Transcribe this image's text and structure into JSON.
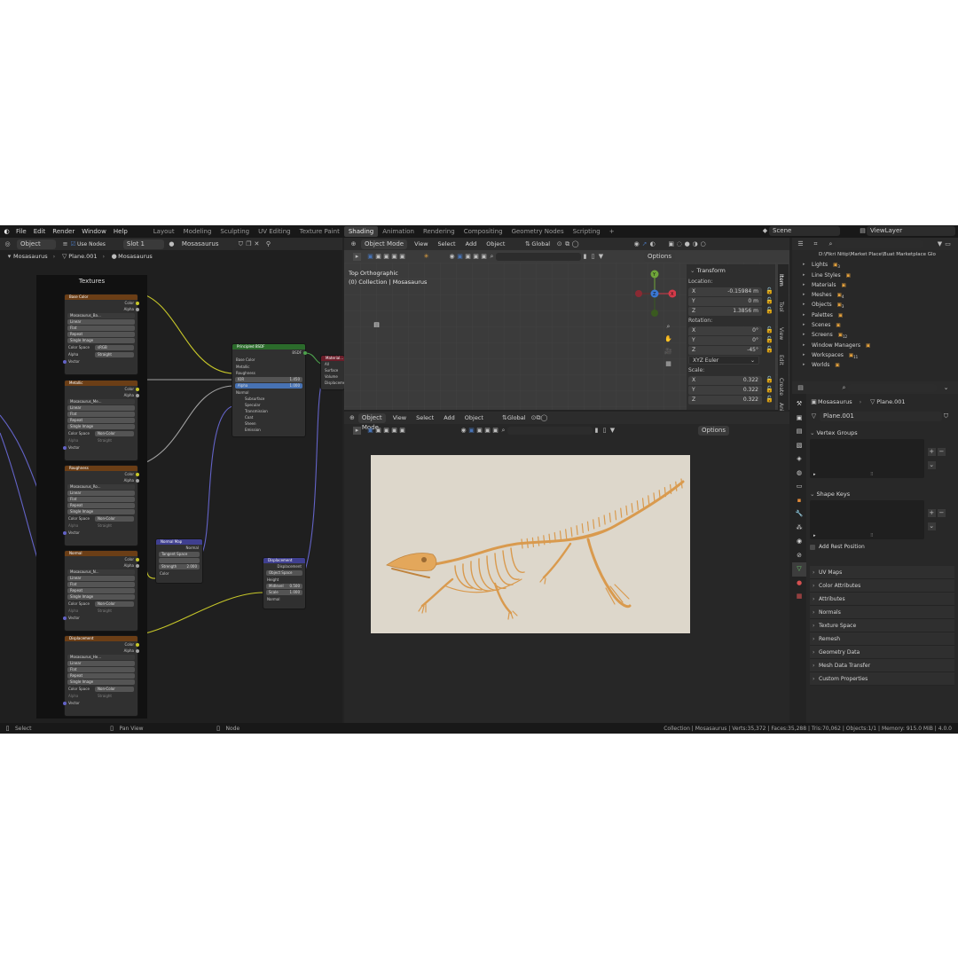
{
  "topbar": {
    "menus": [
      "File",
      "Edit",
      "Render",
      "Window",
      "Help"
    ],
    "workspaces": [
      "Layout",
      "Modeling",
      "Sculpting",
      "UV Editing",
      "Texture Paint",
      "Shading",
      "Animation",
      "Rendering",
      "Compositing",
      "Geometry Nodes",
      "Scripting"
    ],
    "active_workspace": "Shading",
    "add_tab": "+",
    "scene": "Scene",
    "view_layer": "ViewLayer"
  },
  "node_editor": {
    "object_type": "Object",
    "use_nodes": "Use Nodes",
    "slot": "Slot 1",
    "material": "Mosasaurus",
    "breadcrumb": [
      "Mosasaurus",
      "Plane.001",
      "Mosasaurus"
    ],
    "frame_label": "Textures",
    "texture_nodes": [
      {
        "title": "Base Color",
        "image": "Mosasaurus_Ba...",
        "interp": "Linear",
        "proj": "Flat",
        "ext": "Repeat",
        "source": "Single Image",
        "cs_label": "Color Space",
        "cs": "sRGB",
        "alpha_label": "Alpha",
        "alpha": "Straight"
      },
      {
        "title": "Metallic",
        "image": "Mosasaurus_Me...",
        "interp": "Linear",
        "proj": "Flat",
        "ext": "Repeat",
        "source": "Single Image",
        "cs_label": "Color Space",
        "cs": "Non-Color",
        "alpha_label": "Alpha",
        "alpha": "Straight"
      },
      {
        "title": "Roughness",
        "image": "Mosasaurus_Ro...",
        "interp": "Linear",
        "proj": "Flat",
        "ext": "Repeat",
        "source": "Single Image",
        "cs_label": "Color Space",
        "cs": "Non-Color",
        "alpha_label": "Alpha",
        "alpha": "Straight"
      },
      {
        "title": "Normal",
        "image": "Mosasaurus_N...",
        "interp": "Linear",
        "proj": "Flat",
        "ext": "Repeat",
        "source": "Single Image",
        "cs_label": "Color Space",
        "cs": "Non-Color",
        "alpha_label": "Alpha",
        "alpha": "Straight"
      },
      {
        "title": "Displacement",
        "image": "Mosasaurus_He...",
        "interp": "Linear",
        "proj": "Flat",
        "ext": "Repeat",
        "source": "Single Image",
        "cs_label": "Color Space",
        "cs": "Non-Color",
        "alpha_label": "Alpha",
        "alpha": "Straight"
      }
    ],
    "socket_color": "Color",
    "socket_alpha": "Alpha",
    "socket_vector": "Vector",
    "bsdf": {
      "title": "Principled BSDF",
      "out": "BSDF",
      "inputs": [
        "Base Color",
        "Metallic",
        "Roughness"
      ],
      "ior_label": "IOR",
      "ior": "1.450",
      "alpha_label": "Alpha",
      "alpha": "1.000",
      "normal": "Normal",
      "subs": [
        "Subsurface",
        "Specular",
        "Transmission",
        "Coat",
        "Sheen",
        "Emission"
      ]
    },
    "material_output": {
      "title": "Material...",
      "target": "All",
      "inputs": [
        "Surface",
        "Volume",
        "Displacement"
      ]
    },
    "normal_map": {
      "title": "Normal Map",
      "out": "Normal",
      "space": "Tangent Space",
      "strength_label": "Strength",
      "strength": "2.000",
      "color": "Color"
    },
    "displacement": {
      "title": "Displacement",
      "out": "Displacement",
      "space": "Object Space",
      "height": "Height",
      "mid_label": "Midlevel",
      "mid": "0.500",
      "scale_label": "Scale",
      "scale": "1.000",
      "normal": "Normal"
    }
  },
  "viewport_top": {
    "mode": "Object Mode",
    "menus": [
      "View",
      "Select",
      "Add",
      "Object"
    ],
    "orientation": "Global",
    "options": "Options",
    "view_name": "Top Orthographic",
    "collection": "(0) Collection | Mosasaurus",
    "transform": {
      "title": "Transform",
      "location_label": "Location:",
      "location": [
        {
          "axis": "X",
          "value": "-0.15984 m"
        },
        {
          "axis": "Y",
          "value": "0 m"
        },
        {
          "axis": "Z",
          "value": "1.3856 m"
        }
      ],
      "rotation_label": "Rotation:",
      "rotation": [
        {
          "axis": "X",
          "value": "0°"
        },
        {
          "axis": "Y",
          "value": "0°"
        },
        {
          "axis": "Z",
          "value": "-45°"
        }
      ],
      "rotation_mode": "XYZ Euler",
      "scale_label": "Scale:",
      "scale": [
        {
          "axis": "X",
          "value": "0.322"
        },
        {
          "axis": "Y",
          "value": "0.322"
        },
        {
          "axis": "Z",
          "value": "0.322"
        }
      ]
    },
    "side_tabs": [
      "Item",
      "Tool",
      "View",
      "Edit",
      "Create",
      "Animation"
    ]
  },
  "viewport_bottom": {
    "mode": "Object Mode",
    "menus": [
      "View",
      "Select",
      "Add",
      "Object"
    ],
    "orientation": "Global",
    "options": "Options"
  },
  "outliner": {
    "path": "D:\\Fikri Nitip\\Market Place\\Buat Marketplace Glo",
    "items": [
      {
        "label": "Lights",
        "count": "3"
      },
      {
        "label": "Line Styles",
        "count": ""
      },
      {
        "label": "Materials",
        "count": ""
      },
      {
        "label": "Meshes",
        "count": "4"
      },
      {
        "label": "Objects",
        "count": "3"
      },
      {
        "label": "Palettes",
        "count": ""
      },
      {
        "label": "Scenes",
        "count": ""
      },
      {
        "label": "Screens",
        "count": "12"
      },
      {
        "label": "Window Managers",
        "count": ""
      },
      {
        "label": "Workspaces",
        "count": "11"
      },
      {
        "label": "Worlds",
        "count": ""
      }
    ]
  },
  "properties": {
    "object": "Mosasaurus",
    "mesh": "Plane.001",
    "mesh_field": "Plane.001",
    "vertex_groups": "Vertex Groups",
    "shape_keys": "Shape Keys",
    "add_rest": "Add Rest Position",
    "panels": [
      "UV Maps",
      "Color Attributes",
      "Attributes",
      "Normals",
      "Texture Space",
      "Remesh",
      "Geometry Data",
      "Mesh Data Transfer",
      "Custom Properties"
    ]
  },
  "statusbar": {
    "select": "Select",
    "pan": "Pan View",
    "node": "Node",
    "stats": "Collection | Mosasaurus | Verts:35,372 | Faces:35,288 | Tris:70,062 | Objects:1/1 | Memory: 915.0 MiB | 4.0.0"
  },
  "colors": {
    "accent": "#4772b3",
    "texture_header": "#6b3e16",
    "bsdf_header": "#2b6b2b",
    "vector_header": "#3f3f8f",
    "output_header": "#6b1e2a",
    "render_bg": "#ddd7cb",
    "skeleton": "#e0a75c"
  }
}
